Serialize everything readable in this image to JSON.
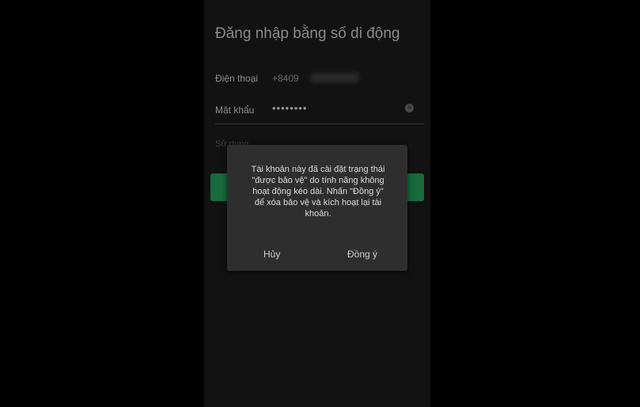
{
  "screen": {
    "title": "Đăng nhập bằng số di động"
  },
  "form": {
    "phone_label": "Điện thoại",
    "phone_value": "+8409",
    "password_label": "Mật khẩu",
    "password_value": "••••••••",
    "clear_icon": "×",
    "hint": "Sử dụng ..."
  },
  "dialog": {
    "message": "Tài khoản này đã cài đặt trạng thái\n\"được bảo vệ\" do tính năng không\nhoạt động kéo dài. Nhấn \"Đồng ý\"\nđể xóa bảo vệ và kích hoạt lại tài\nkhoản.",
    "cancel_label": "Hủy",
    "ok_label": "Đồng ý"
  },
  "colors": {
    "background": "#000000",
    "phone_bg": "#121212",
    "dialog_bg": "#2e2e2e",
    "accent_green": "#176b3c"
  }
}
